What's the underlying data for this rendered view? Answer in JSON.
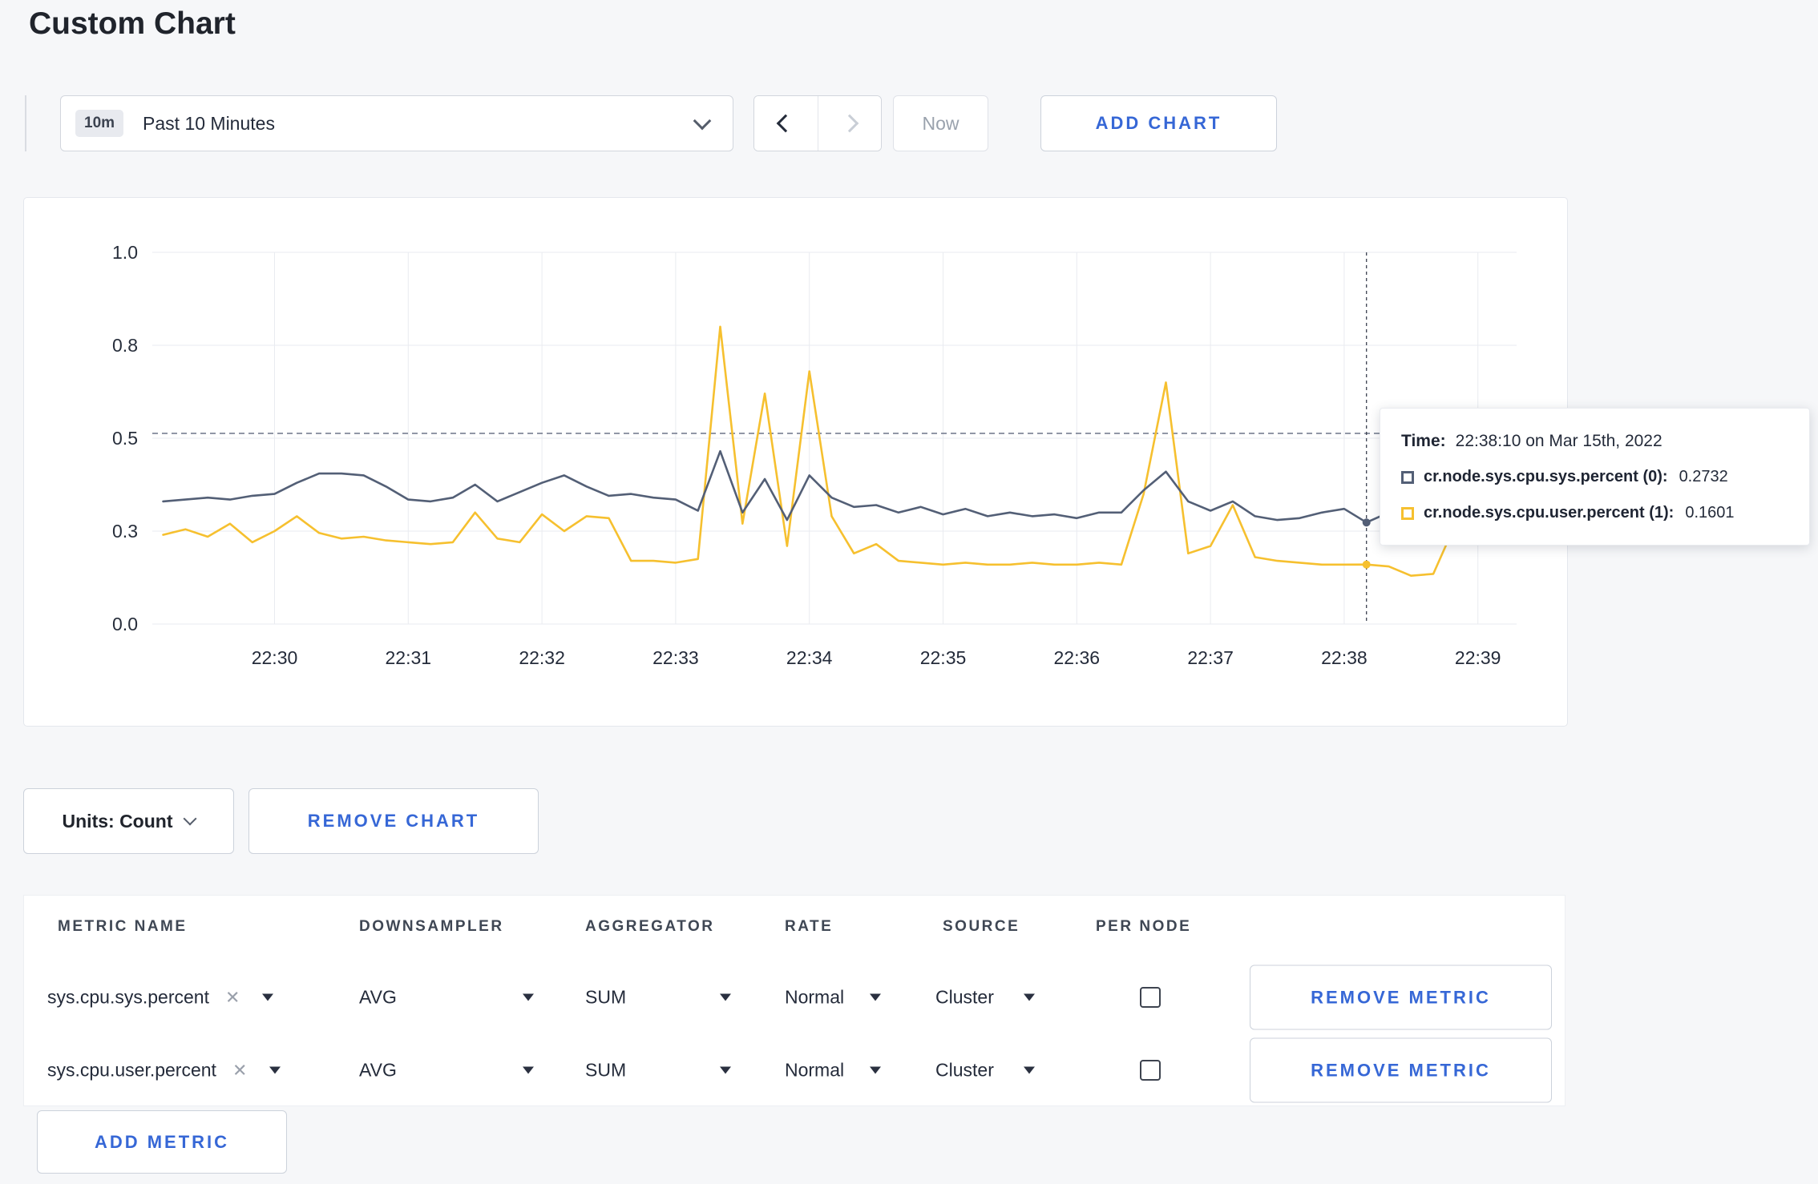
{
  "page": {
    "title": "Custom Chart"
  },
  "colors": {
    "accent_blue": "#3667d6",
    "series_sys": "#535f76",
    "series_user": "#f6c02f"
  },
  "toolbar": {
    "time_range": {
      "badge": "10m",
      "label": "Past 10 Minutes"
    },
    "now_label": "Now",
    "add_chart_label": "ADD CHART"
  },
  "tooltip": {
    "time_label": "Time:",
    "time_value": "22:38:10 on Mar 15th, 2022",
    "rows": [
      {
        "label": "cr.node.sys.cpu.sys.percent (0):",
        "value": "0.2732"
      },
      {
        "label": "cr.node.sys.cpu.user.percent (1):",
        "value": "0.1601"
      }
    ]
  },
  "chart_controls": {
    "units_label": "Units: Count",
    "remove_chart_label": "REMOVE CHART"
  },
  "metrics_table": {
    "headers": [
      "METRIC NAME",
      "DOWNSAMPLER",
      "AGGREGATOR",
      "RATE",
      "SOURCE",
      "PER NODE"
    ],
    "rows": [
      {
        "metric": "sys.cpu.sys.percent",
        "downsampler": "AVG",
        "aggregator": "SUM",
        "rate": "Normal",
        "source": "Cluster",
        "per_node_checked": false,
        "remove_label": "REMOVE METRIC"
      },
      {
        "metric": "sys.cpu.user.percent",
        "downsampler": "AVG",
        "aggregator": "SUM",
        "rate": "Normal",
        "source": "Cluster",
        "per_node_checked": false,
        "remove_label": "REMOVE METRIC"
      }
    ],
    "add_metric_label": "ADD METRIC"
  },
  "chart_data": {
    "type": "line",
    "title": "",
    "xlabel": "",
    "ylabel": "",
    "ylim": [
      0,
      1
    ],
    "x_ticks": [
      "22:30",
      "22:31",
      "22:32",
      "22:33",
      "22:34",
      "22:35",
      "22:36",
      "22:37",
      "22:38",
      "22:39"
    ],
    "y_ticks": [
      {
        "value": 0,
        "label": "0.0"
      },
      {
        "value": 0.25,
        "label": "0.3"
      },
      {
        "value": 0.5,
        "label": "0.5"
      },
      {
        "value": 0.75,
        "label": "0.8"
      },
      {
        "value": 1,
        "label": "1.0"
      }
    ],
    "start_time": "22:29:10",
    "interval_seconds": 10,
    "threshold_value": 0.513,
    "series": [
      {
        "name": "cr.node.sys.cpu.sys.percent",
        "color": "#535f76",
        "values": [
          0.33,
          0.335,
          0.34,
          0.335,
          0.345,
          0.35,
          0.38,
          0.405,
          0.405,
          0.4,
          0.37,
          0.335,
          0.33,
          0.34,
          0.375,
          0.33,
          0.355,
          0.38,
          0.4,
          0.37,
          0.345,
          0.35,
          0.34,
          0.335,
          0.305,
          0.465,
          0.3,
          0.39,
          0.28,
          0.4,
          0.34,
          0.315,
          0.32,
          0.3,
          0.315,
          0.295,
          0.31,
          0.29,
          0.3,
          0.29,
          0.295,
          0.285,
          0.3,
          0.3,
          0.36,
          0.41,
          0.33,
          0.305,
          0.33,
          0.29,
          0.28,
          0.285,
          0.3,
          0.31,
          0.2732,
          0.3,
          0.315,
          0.3,
          0.3,
          0.31
        ]
      },
      {
        "name": "cr.node.sys.cpu.user.percent",
        "color": "#f6c02f",
        "values": [
          0.24,
          0.255,
          0.235,
          0.27,
          0.22,
          0.25,
          0.29,
          0.245,
          0.23,
          0.235,
          0.225,
          0.22,
          0.215,
          0.22,
          0.3,
          0.23,
          0.22,
          0.295,
          0.25,
          0.29,
          0.285,
          0.17,
          0.17,
          0.165,
          0.175,
          0.8,
          0.27,
          0.62,
          0.21,
          0.68,
          0.29,
          0.19,
          0.215,
          0.17,
          0.165,
          0.16,
          0.165,
          0.16,
          0.16,
          0.165,
          0.16,
          0.16,
          0.165,
          0.16,
          0.35,
          0.65,
          0.19,
          0.21,
          0.32,
          0.18,
          0.17,
          0.165,
          0.16,
          0.16,
          0.1601,
          0.155,
          0.13,
          0.135,
          0.27,
          0.23
        ]
      }
    ],
    "crosshair": {
      "time": "22:38:10",
      "values": [
        0.2732,
        0.1601
      ]
    }
  }
}
